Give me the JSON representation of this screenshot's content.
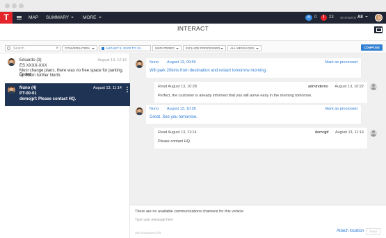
{
  "header": {
    "logo": "T",
    "nav": [
      {
        "label": "MAP",
        "caret": false
      },
      {
        "label": "SUMMARY",
        "caret": true
      },
      {
        "label": "MORE",
        "caret": true
      }
    ],
    "mail_count": "0",
    "alert_count": "23",
    "alert_glyph": "!",
    "showing_label": "SHOWING",
    "showing_value": "All"
  },
  "page_title": "INTERACT",
  "filters": {
    "search_placeholder": "Search",
    "clear_glyph": "×",
    "conversation": "CONVERSATION",
    "date_range": "AUGUST 8, 23:00 TO 13...",
    "unfiltered": "UNFILTERED",
    "processed": "INCLUDE PROCESSED",
    "messages": "ALL MESSAGES",
    "compose": "COMPOSE"
  },
  "conversations": [
    {
      "name": "Eduardo (3)",
      "date": "August 13, 12:13",
      "lines": [
        "ES XXXX-XXX",
        "Must change plans, there was no free space for parking. Ended",
        "up 55km further North."
      ],
      "selected": false
    },
    {
      "name": "Nuno (4)",
      "date": "August 13, 11:14",
      "lines": [
        "PT-00-01",
        "demojpf: Please contact HQ."
      ],
      "selected": true
    }
  ],
  "messages": [
    {
      "type": "in",
      "sender": "Nuno",
      "time": "August 13, 09:59",
      "action": "Mark as processed",
      "text": "Will park 20kms from destination and restart tomorrow morning."
    },
    {
      "type": "out",
      "read": "Read August 13, 10:28",
      "user": "admindemo",
      "time": "August 13, 10:22",
      "text": "Perfect, the customer is already informed that you will arrive early in the morning tomorrow."
    },
    {
      "type": "in",
      "sender": "Nuno",
      "time": "August 13, 10:28",
      "action": "Mark as processed",
      "text": "Great. See you tomorrow."
    },
    {
      "type": "out",
      "read": "Read August 13, 11:14",
      "user": "demojpf",
      "time": "August 13, 11:14",
      "text": "Please contact HQ."
    }
  ],
  "composer": {
    "notice": "There are no available communications channels for this vehicle",
    "placeholder": "Type your message here",
    "chars_left": "300 characters left",
    "attach": "Attach location",
    "send": "Send"
  },
  "colors": {
    "topbar": "#1f2533",
    "brand": "#e3242b",
    "selected_row": "#1f3355",
    "link": "#2a7bd4",
    "compose_button": "#2f7fd1"
  }
}
